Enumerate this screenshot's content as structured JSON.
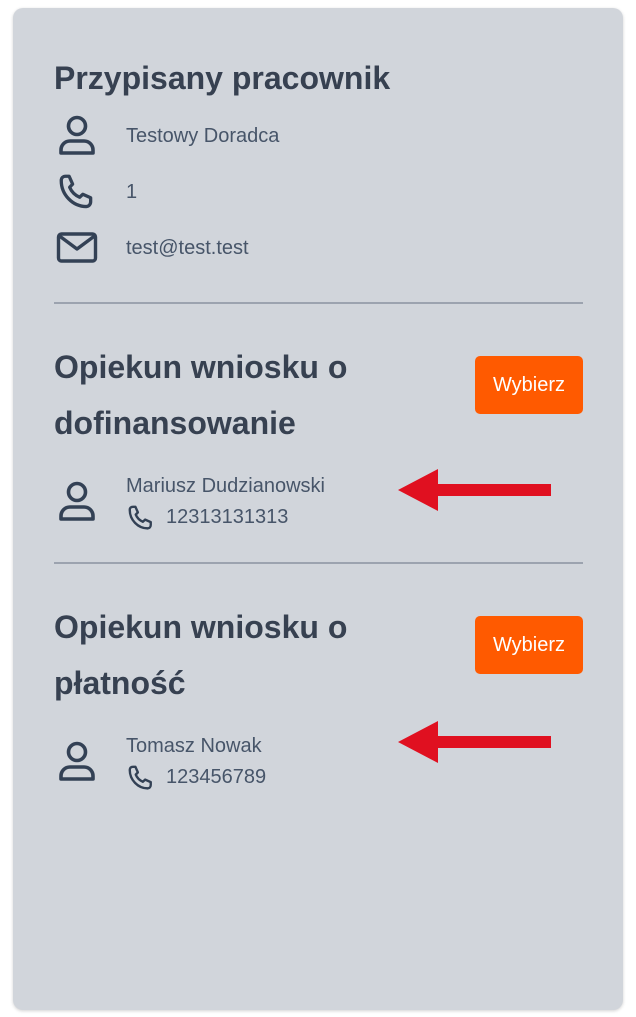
{
  "assigned": {
    "title": "Przypisany pracownik",
    "name": "Testowy Doradca",
    "phone": "1",
    "email": "test@test.test"
  },
  "guardians": [
    {
      "title": "Opiekun wniosku o dofinansowanie",
      "button_label": "Wybierz",
      "name": "Mariusz Dudzianowski",
      "phone": "12313131313"
    },
    {
      "title": "Opiekun wniosku o płatność",
      "button_label": "Wybierz",
      "name": "Tomasz Nowak",
      "phone": "123456789"
    }
  ],
  "colors": {
    "card_bg": "#d1d5db",
    "text": "#374151",
    "button_bg": "#ff5a00",
    "arrow": "#e01020"
  },
  "icons": [
    "user-icon",
    "phone-icon",
    "mail-icon",
    "arrow-left-icon"
  ]
}
